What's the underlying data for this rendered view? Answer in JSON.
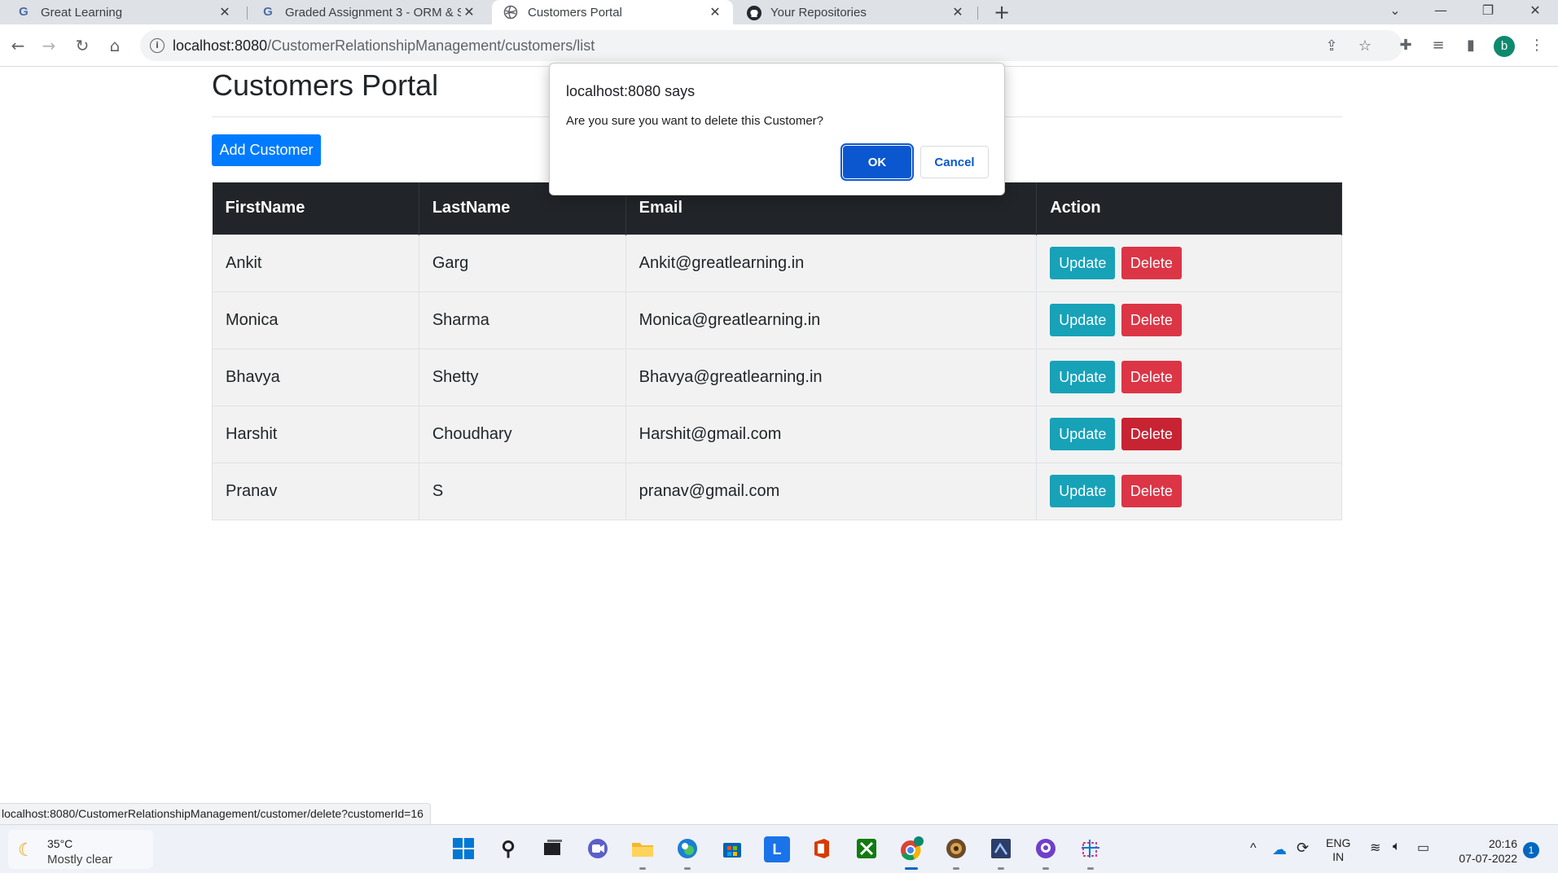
{
  "browser": {
    "tabs": [
      {
        "title": "Great Learning",
        "icon": "g-icon"
      },
      {
        "title": "Graded Assignment 3 - ORM & S",
        "icon": "g-icon"
      },
      {
        "title": "Customers Portal",
        "icon": "globe-icon",
        "active": true
      },
      {
        "title": "Your Repositories",
        "icon": "github-icon"
      }
    ],
    "url_host": "localhost:8080",
    "url_path": "/CustomerRelationshipManagement/customers/list",
    "profile_initial": "b"
  },
  "page": {
    "title": "Customers Portal",
    "add_button": "Add Customer",
    "table": {
      "headers": [
        "FirstName",
        "LastName",
        "Email",
        "Action"
      ],
      "rows": [
        {
          "first": "Ankit",
          "last": "Garg",
          "email": "Ankit@greatlearning.in"
        },
        {
          "first": "Monica",
          "last": "Sharma",
          "email": "Monica@greatlearning.in"
        },
        {
          "first": "Bhavya",
          "last": "Shetty",
          "email": "Bhavya@greatlearning.in"
        },
        {
          "first": "Harshit",
          "last": "Choudhary",
          "email": "Harshit@gmail.com"
        },
        {
          "first": "Pranav",
          "last": "S",
          "email": "pranav@gmail.com"
        }
      ],
      "update_label": "Update",
      "delete_label": "Delete"
    }
  },
  "dialog": {
    "title": "localhost:8080 says",
    "message": "Are you sure you want to delete this Customer?",
    "ok_label": "OK",
    "cancel_label": "Cancel"
  },
  "status_url": "localhost:8080/CustomerRelationshipManagement/customer/delete?customerId=16",
  "taskbar": {
    "weather_temp": "35°C",
    "weather_condition": "Mostly clear",
    "language": "ENG",
    "region": "IN",
    "time": "20:16",
    "date": "07-07-2022",
    "notification_count": "1"
  },
  "colors": {
    "primary": "#007bff",
    "info": "#17a2b8",
    "danger": "#dc3545",
    "header_dark": "#212529",
    "dialog_ok": "#0b57d0"
  }
}
